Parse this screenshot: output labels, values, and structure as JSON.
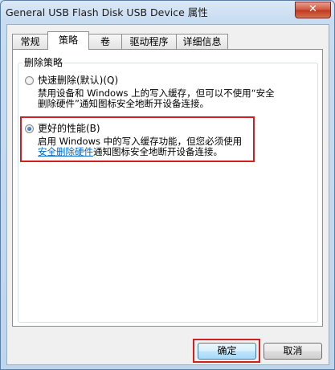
{
  "window": {
    "title": "General USB Flash Disk USB Device 属性",
    "close_glyph": "✕"
  },
  "tabs": [
    {
      "label": "常规"
    },
    {
      "label": "策略"
    },
    {
      "label": "卷"
    },
    {
      "label": "驱动程序"
    },
    {
      "label": "详细信息"
    }
  ],
  "active_tab": "策略",
  "removal_policy": {
    "legend": "删除策略",
    "quick_removal": {
      "label": "快速删除(默认)(Q)",
      "selected": false,
      "description_line1": "禁用设备和 Windows 上的写入缓存，但可以不使用“安全",
      "description_line2": "删除硬件”通知图标安全地断开设备连接。"
    },
    "better_performance": {
      "label": "更好的性能(B)",
      "selected": true,
      "description_line1": "启用 Windows 中的写入缓存功能，但您必须使用",
      "link_text": "安全删除硬件",
      "description_line2_rest": "通知图标安全地断开设备连接。"
    }
  },
  "buttons": {
    "ok_label": "确定",
    "cancel_label": "取消"
  },
  "colors": {
    "highlight_border": "#d21f1f",
    "link": "#0066cc"
  }
}
